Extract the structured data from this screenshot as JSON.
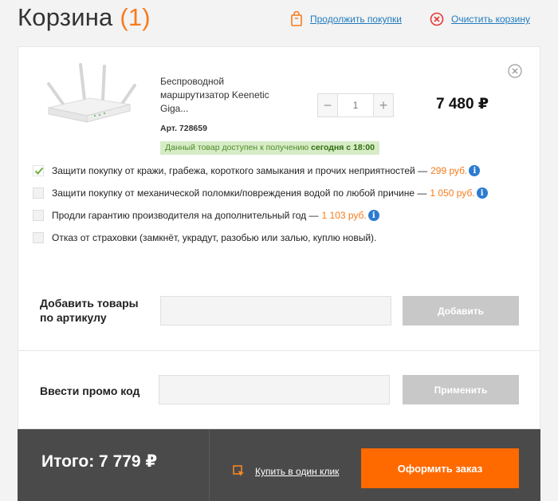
{
  "header": {
    "title": "Корзина",
    "count": "(1)",
    "continue_label": "Продолжить покупки",
    "clear_label": "Очистить корзину"
  },
  "product": {
    "name_lines": [
      "Беспроводной",
      "маршрутизатор Keenetic",
      "Giga..."
    ],
    "article": "Арт. 728659",
    "availability_prefix": "Данный товар доступен к получению",
    "availability_bold": "сегодня с 18:00",
    "quantity": "1",
    "minus": "−",
    "plus": "+",
    "price": "7 480 ₽"
  },
  "options": [
    {
      "text": "Защити покупку от кражи, грабежа, короткого замыкания и прочих неприятностей —",
      "price": "299 руб.",
      "checked": true,
      "info": "i"
    },
    {
      "text": "Защити покупку от механической поломки/повреждения водой по любой причине —",
      "price": "1 050 руб.",
      "checked": false,
      "info": "i"
    },
    {
      "text": "Продли гарантию производителя на дополнительный год —",
      "price": "1 103 руб.",
      "checked": false,
      "info": "i"
    },
    {
      "text": "Отказ от страховки (замкнёт, украдут, разобью или залью, куплю новый).",
      "price": "",
      "checked": false,
      "info": ""
    }
  ],
  "add_by_article": {
    "label_line1": "Добавить товары",
    "label_line2": "по артикулу",
    "button": "Добавить",
    "value": ""
  },
  "promo": {
    "label": "Ввести промо код",
    "button": "Применить",
    "value": ""
  },
  "footer": {
    "total": "Итого: 7 779 ₽",
    "one_click": "Купить в один клик",
    "checkout": "Оформить заказ"
  },
  "colors": {
    "accent": "#f57c1f",
    "checkout": "#ff6a00",
    "link": "#1f7bbf",
    "info": "#2c7bd0",
    "footer_bg": "#4a4a4a"
  }
}
